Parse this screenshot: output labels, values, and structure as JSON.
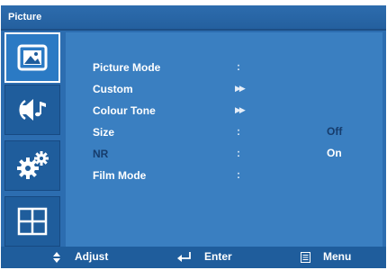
{
  "window": {
    "title": "Picture"
  },
  "sidebar": {
    "tabs": [
      {
        "name": "picture",
        "icon": "picture-icon",
        "active": true
      },
      {
        "name": "sound",
        "icon": "sound-icon",
        "active": false
      },
      {
        "name": "setup",
        "icon": "gears-icon",
        "active": false
      },
      {
        "name": "layout",
        "icon": "grid-icon",
        "active": false
      }
    ]
  },
  "menu": {
    "items": [
      {
        "label": "Picture Mode",
        "separator": ":",
        "value": "",
        "dimmed": false
      },
      {
        "label": "Custom",
        "separator": "▶▶",
        "value": "",
        "dimmed": false
      },
      {
        "label": "Colour Tone",
        "separator": "▶▶",
        "value": "",
        "dimmed": false
      },
      {
        "label": "Size",
        "separator": ":",
        "value": "Off",
        "dimmed": false
      },
      {
        "label": "NR",
        "separator": ":",
        "value": "On",
        "dimmed": true
      },
      {
        "label": "Film Mode",
        "separator": ":",
        "value": "",
        "dimmed": false
      }
    ],
    "value_colors": {
      "Off": "#163c6c",
      "On": "#ffffff"
    }
  },
  "footer": {
    "adjust_label": "Adjust",
    "enter_label": "Enter",
    "menu_label": "Menu"
  },
  "colors": {
    "panel": "#3a7fc1",
    "frame": "#2c6db0",
    "dim_text": "#163c6c"
  }
}
